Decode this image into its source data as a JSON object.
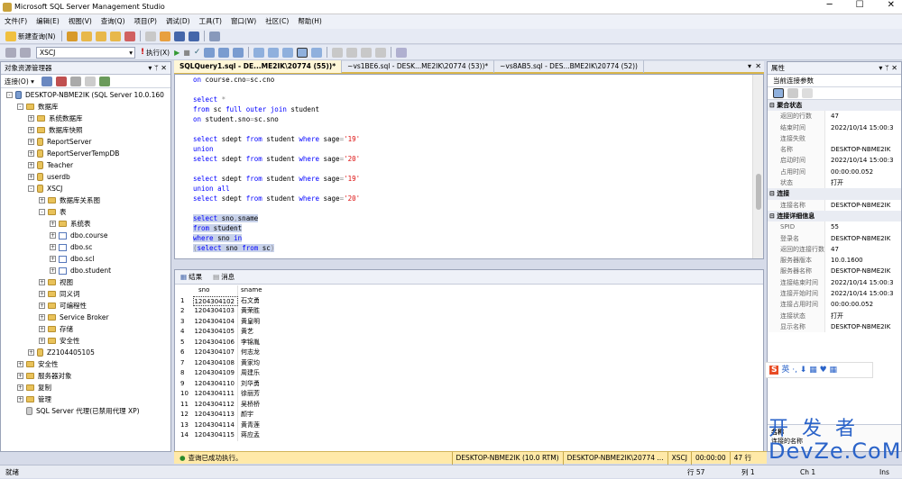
{
  "app": {
    "title": "Microsoft SQL Server Management Studio"
  },
  "menu": [
    "文件(F)",
    "编辑(E)",
    "视图(V)",
    "查询(Q)",
    "项目(P)",
    "调试(D)",
    "工具(T)",
    "窗口(W)",
    "社区(C)",
    "帮助(H)"
  ],
  "toolbar": {
    "new_query": "新建查询(N)",
    "database": "XSCJ",
    "execute": "执行(X)"
  },
  "object_explorer": {
    "title": "对象资源管理器",
    "connect": "连接(O) ▾",
    "tree": [
      {
        "label": "DESKTOP-NBME2IK (SQL Server 10.0.160",
        "depth": 0,
        "icon": "server-icon",
        "pm": "-"
      },
      {
        "label": "数据库",
        "depth": 1,
        "icon": "folder-icon",
        "pm": "-"
      },
      {
        "label": "系统数据库",
        "depth": 2,
        "icon": "folder-icon",
        "pm": "+"
      },
      {
        "label": "数据库快照",
        "depth": 2,
        "icon": "folder-icon",
        "pm": "+"
      },
      {
        "label": "ReportServer",
        "depth": 2,
        "icon": "database-icon",
        "pm": "+"
      },
      {
        "label": "ReportServerTempDB",
        "depth": 2,
        "icon": "database-icon",
        "pm": "+"
      },
      {
        "label": "Teacher",
        "depth": 2,
        "icon": "database-icon",
        "pm": "+"
      },
      {
        "label": "userdb",
        "depth": 2,
        "icon": "database-icon",
        "pm": "+"
      },
      {
        "label": "XSCJ",
        "depth": 2,
        "icon": "database-icon",
        "pm": "-"
      },
      {
        "label": "数据库关系图",
        "depth": 3,
        "icon": "folder-icon",
        "pm": "+"
      },
      {
        "label": "表",
        "depth": 3,
        "icon": "folder-icon",
        "pm": "-"
      },
      {
        "label": "系统表",
        "depth": 4,
        "icon": "folder-icon",
        "pm": "+"
      },
      {
        "label": "dbo.course",
        "depth": 4,
        "icon": "table-icon",
        "pm": "+"
      },
      {
        "label": "dbo.sc",
        "depth": 4,
        "icon": "table-icon",
        "pm": "+"
      },
      {
        "label": "dbo.scl",
        "depth": 4,
        "icon": "table-icon",
        "pm": "+"
      },
      {
        "label": "dbo.student",
        "depth": 4,
        "icon": "table-icon",
        "pm": "+"
      },
      {
        "label": "视图",
        "depth": 3,
        "icon": "folder-icon",
        "pm": "+"
      },
      {
        "label": "同义词",
        "depth": 3,
        "icon": "folder-icon",
        "pm": "+"
      },
      {
        "label": "可编程性",
        "depth": 3,
        "icon": "folder-icon",
        "pm": "+"
      },
      {
        "label": "Service Broker",
        "depth": 3,
        "icon": "folder-icon",
        "pm": "+"
      },
      {
        "label": "存储",
        "depth": 3,
        "icon": "folder-icon",
        "pm": "+"
      },
      {
        "label": "安全性",
        "depth": 3,
        "icon": "folder-icon",
        "pm": "+"
      },
      {
        "label": "Z2104405105",
        "depth": 2,
        "icon": "database-icon",
        "pm": "+"
      },
      {
        "label": "安全性",
        "depth": 1,
        "icon": "folder-icon",
        "pm": "+"
      },
      {
        "label": "服务器对象",
        "depth": 1,
        "icon": "folder-icon",
        "pm": "+"
      },
      {
        "label": "复制",
        "depth": 1,
        "icon": "folder-icon",
        "pm": "+"
      },
      {
        "label": "管理",
        "depth": 1,
        "icon": "folder-icon",
        "pm": "+"
      },
      {
        "label": "SQL Server 代理(已禁用代理 XP)",
        "depth": 1,
        "icon": "agent-icon",
        "pm": ""
      }
    ]
  },
  "tabs": [
    {
      "label": "SQLQuery1.sql - DE...ME2IK\\20774 (55))*",
      "active": true
    },
    {
      "label": "~vs1BE6.sql - DESK...ME2IK\\20774 (53))*",
      "active": false
    },
    {
      "label": "~vs8AB5.sql - DES...BME2IK\\20774 (52))",
      "active": false
    }
  ],
  "editor_lines": [
    {
      "text": "on course.cno=sc.cno",
      "sel": false
    },
    {
      "text": "",
      "sel": false
    },
    {
      "text": "select *",
      "sel": false
    },
    {
      "text": "from sc full outer join student",
      "sel": false
    },
    {
      "text": "on student.sno=sc.sno",
      "sel": false
    },
    {
      "text": "",
      "sel": false
    },
    {
      "text": "select sdept from student where sage='19'",
      "sel": false
    },
    {
      "text": "union",
      "sel": false
    },
    {
      "text": "select sdept from student where sage='20'",
      "sel": false
    },
    {
      "text": "",
      "sel": false
    },
    {
      "text": "select sdept from student where sage='19'",
      "sel": false
    },
    {
      "text": "union all",
      "sel": false
    },
    {
      "text": "select sdept from student where sage='20'",
      "sel": false
    },
    {
      "text": "",
      "sel": false
    },
    {
      "text": "select sno,sname",
      "sel": true
    },
    {
      "text": "from student",
      "sel": true
    },
    {
      "text": "where sno in",
      "sel": true
    },
    {
      "text": "(select sno from sc)",
      "sel": true
    }
  ],
  "results": {
    "tab_results": "结果",
    "tab_messages": "消息",
    "columns": [
      "sno",
      "sname"
    ],
    "rows": [
      [
        "1",
        "1204304102",
        "石文勇"
      ],
      [
        "2",
        "1204304103",
        "黄荣胜"
      ],
      [
        "3",
        "1204304104",
        "黄皇明"
      ],
      [
        "4",
        "1204304105",
        "黄艺"
      ],
      [
        "5",
        "1204304106",
        "李锦胤"
      ],
      [
        "6",
        "1204304107",
        "何志龙"
      ],
      [
        "7",
        "1204304108",
        "黄家均"
      ],
      [
        "8",
        "1204304109",
        "周建乐"
      ],
      [
        "9",
        "1204304110",
        "刘华勇"
      ],
      [
        "10",
        "1204304111",
        "徐丽芳"
      ],
      [
        "11",
        "1204304112",
        "吴桥桥"
      ],
      [
        "12",
        "1204304113",
        "颜宇"
      ],
      [
        "13",
        "1204304114",
        "黄青莲"
      ],
      [
        "14",
        "1204304115",
        "蒋应孟"
      ]
    ]
  },
  "status": {
    "message": "查询已成功执行。",
    "server": "DESKTOP-NBME2IK (10.0 RTM)",
    "user": "DESKTOP-NBME2IK\\20774 ...",
    "db": "XSCJ",
    "time": "00:00:00",
    "rows": "47 行"
  },
  "bottom": {
    "ready": "就绪",
    "line": "行 57",
    "col": "列 1",
    "ch": "Ch 1",
    "ins": "Ins"
  },
  "properties": {
    "title": "属性",
    "dropdown": "当前连接参数",
    "rows": [
      {
        "k": "聚合状态",
        "v": "",
        "cat": true
      },
      {
        "k": "返回的行数",
        "v": "47"
      },
      {
        "k": "结束时间",
        "v": "2022/10/14 15:00:3"
      },
      {
        "k": "连接失败",
        "v": ""
      },
      {
        "k": "名称",
        "v": "DESKTOP-NBME2IK"
      },
      {
        "k": "启动时间",
        "v": "2022/10/14 15:00:3"
      },
      {
        "k": "占用时间",
        "v": "00:00:00.052"
      },
      {
        "k": "状态",
        "v": "打开"
      },
      {
        "k": "连接",
        "v": "",
        "cat": true
      },
      {
        "k": "连接名称",
        "v": "DESKTOP-NBME2IK"
      },
      {
        "k": "连接详细信息",
        "v": "",
        "cat": true
      },
      {
        "k": "SPID",
        "v": "55"
      },
      {
        "k": "登录名",
        "v": "DESKTOP-NBME2IK"
      },
      {
        "k": "返回的连接行数",
        "v": "47"
      },
      {
        "k": "服务器版本",
        "v": "10.0.1600"
      },
      {
        "k": "服务器名称",
        "v": "DESKTOP-NBME2IK"
      },
      {
        "k": "连接结束时间",
        "v": "2022/10/14 15:00:3"
      },
      {
        "k": "连接开始时间",
        "v": "2022/10/14 15:00:3"
      },
      {
        "k": "连接占用时间",
        "v": "00:00:00.052"
      },
      {
        "k": "连接状态",
        "v": "打开"
      },
      {
        "k": "显示名称",
        "v": "DESKTOP-NBME2IK"
      }
    ],
    "bottom_label": "连接的名称",
    "bottom_header": "名称"
  },
  "ime": {
    "text": "英 ·, ⬇ ▦ ♥ ▦"
  },
  "watermark": {
    "line1": "开 发 者",
    "line2": "DevZe.CoM"
  }
}
